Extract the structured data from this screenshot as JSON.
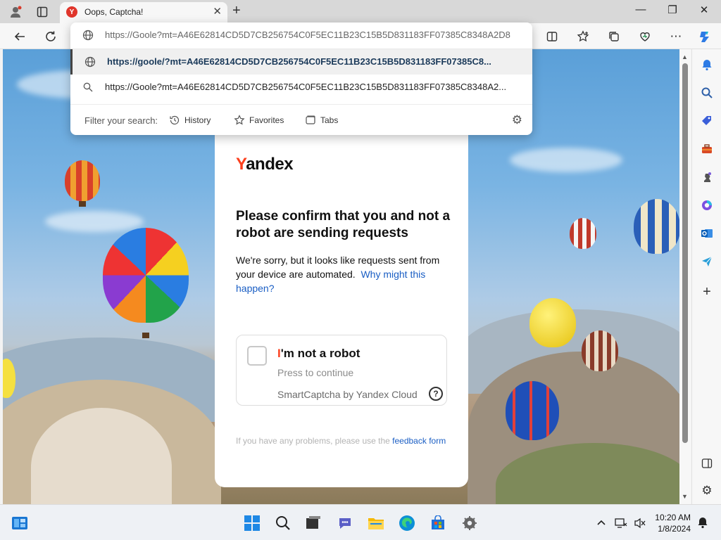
{
  "browser": {
    "tab": {
      "title": "Oops, Captcha!",
      "favicon": "Y"
    },
    "window_controls": {
      "minimize": "—",
      "restore": "❐",
      "close": "✕"
    }
  },
  "omnibox": {
    "input_value": "https://Goole?mt=A46E62814CD5D7CB256754C0F5EC11B23C15B5D831183FF07385C8348A2D8",
    "suggestions": [
      {
        "icon": "globe-icon",
        "text": "https://goole/?mt=A46E62814CD5D7CB256754C0F5EC11B23C15B5D831183FF07385C8...",
        "selected": true
      },
      {
        "icon": "search-icon",
        "text": "https://Goole?mt=A46E62814CD5D7CB256754C0F5EC11B23C15B5D831183FF07385C8348A2...",
        "selected": false
      }
    ],
    "filter": {
      "label": "Filter your search:",
      "chips": [
        "History",
        "Favorites",
        "Tabs"
      ]
    }
  },
  "page": {
    "logo_y": "Y",
    "logo_rest": "andex",
    "heading": "Please confirm that you and not a robot are sending requests",
    "description": "We're sorry, but it looks like requests sent from your device are automated.",
    "why_link": "Why might this happen?",
    "captcha": {
      "title_first": "I",
      "title_rest": "'m not a robot",
      "subtitle": "Press to continue",
      "brand": "SmartCaptcha by Yandex Cloud",
      "help": "?"
    },
    "footer_text": "If you have any problems, please use the",
    "footer_link": "feedback form"
  },
  "taskbar": {
    "time": "10:20 AM",
    "date": "1/8/2024"
  },
  "colors": {
    "yandex_red": "#fc3f1d",
    "link_blue": "#1a5ec4"
  }
}
